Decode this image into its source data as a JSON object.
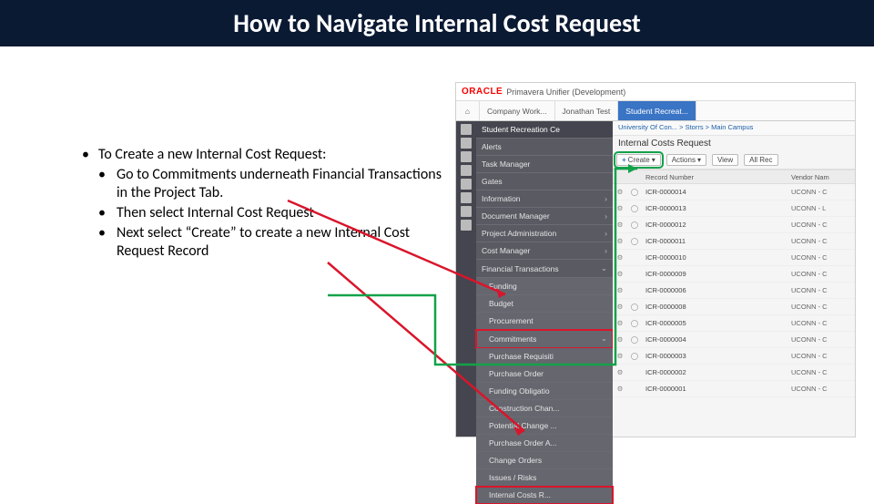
{
  "title": "How to Navigate Internal Cost Request",
  "bullets": {
    "top": "To Create a new Internal Cost Request:",
    "sub1": "Go to Commitments underneath Financial Transactions in the Project Tab.",
    "sub2": "Then select Internal Cost Request",
    "sub3": "Next select “Create” to create a new Internal Cost Request Record"
  },
  "app": {
    "brand": "ORACLE",
    "product": "Primavera Unifier (Development)",
    "tabs": [
      "Company Work...",
      "Jonathan Test",
      "Student Recreat..."
    ],
    "breadcrumb": "University Of Con...   >   Storrs   >   Main Campus",
    "panel_title": "Internal Costs Request",
    "toolbar": {
      "create": "Create",
      "actions": "Actions",
      "view": "View",
      "all": "All Rec"
    },
    "columns": {
      "rec": "Record Number",
      "vendor": "Vendor Nam"
    },
    "nav": {
      "project": "Student Recreation Ce",
      "alerts": "Alerts",
      "task_mgr": "Task Manager",
      "gates": "Gates",
      "info": "Information",
      "doc_mgr": "Document Manager",
      "proj_admin": "Project Administration",
      "cost_mgr": "Cost Manager",
      "fin": "Financial Transactions",
      "funding": "Funding",
      "budget": "Budget",
      "procurement": "Procurement",
      "commitments": "Commitments",
      "pr": "Purchase Requisiti",
      "po": "Purchase Order",
      "fo": "Funding Obligatio",
      "cc": "Construction Chan...",
      "pc": "Potential Change ...",
      "poa": "Purchase Order A...",
      "co": "Change Orders",
      "ir": "Issues / Risks",
      "icr": "Internal Costs R..."
    },
    "rows": [
      {
        "rec": "ICR-0000014",
        "vendor": "UCONN - C",
        "flag": "◯"
      },
      {
        "rec": "ICR-0000013",
        "vendor": "UCONN - L",
        "flag": "◯"
      },
      {
        "rec": "ICR-0000012",
        "vendor": "UCONN - C",
        "flag": "◯"
      },
      {
        "rec": "ICR-0000011",
        "vendor": "UCONN - C",
        "flag": "◯"
      },
      {
        "rec": "ICR-0000010",
        "vendor": "UCONN - C",
        "flag": ""
      },
      {
        "rec": "ICR-0000009",
        "vendor": "UCONN - C",
        "flag": ""
      },
      {
        "rec": "ICR-0000006",
        "vendor": "UCONN - C",
        "flag": ""
      },
      {
        "rec": "ICR-0000008",
        "vendor": "UCONN - C",
        "flag": "◯"
      },
      {
        "rec": "ICR-0000005",
        "vendor": "UCONN - C",
        "flag": "◯"
      },
      {
        "rec": "ICR-0000004",
        "vendor": "UCONN - C",
        "flag": "◯"
      },
      {
        "rec": "ICR-0000003",
        "vendor": "UCONN - C",
        "flag": "◯"
      },
      {
        "rec": "ICR-0000002",
        "vendor": "UCONN - C",
        "flag": ""
      },
      {
        "rec": "ICR-0000001",
        "vendor": "UCONN - C",
        "flag": ""
      }
    ]
  }
}
